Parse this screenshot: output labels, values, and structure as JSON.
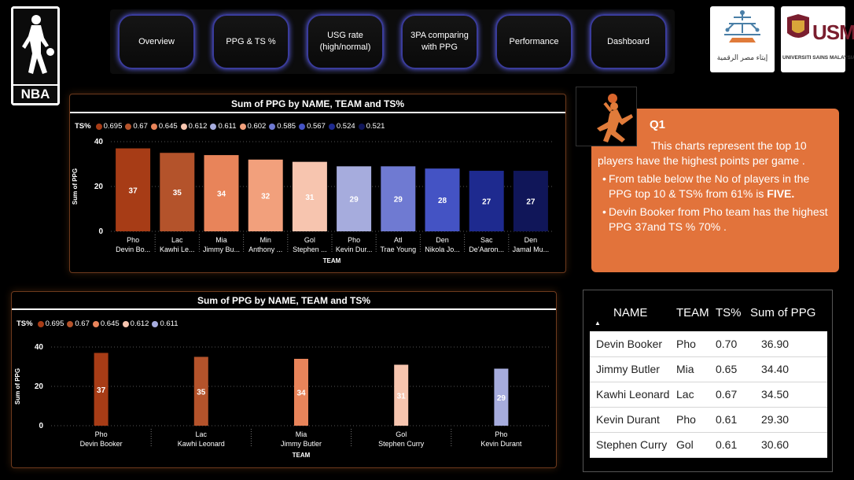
{
  "logos": {
    "nba_text": "NBA",
    "egypt_text": "إيتاء مصر الرقمية",
    "usm_short": "USM",
    "usm_text": "UNIVERSITI SAINS MALAYSIA"
  },
  "nav": {
    "buttons": [
      {
        "label": "Overview"
      },
      {
        "label": "PPG & TS %"
      },
      {
        "label": "USG rate (high/normal)"
      },
      {
        "label": "3PA comparing with PPG"
      },
      {
        "label": "Performance"
      },
      {
        "label": "Dashboard"
      }
    ]
  },
  "colors": {
    "c0695": "#a73c16",
    "c067": "#b4532b",
    "c0645": "#e8845a",
    "c0612": "#f7c5af",
    "c0611": "#a6acdd",
    "c0602": "#f2a07c",
    "c0585": "#6f7ad2",
    "c0567": "#4453c4",
    "c0524": "#1e2a8f",
    "c0521": "#101659",
    "info_bg": "#e2733b",
    "card_border": "#6e3a1d",
    "nav_border": "#3a3c9c"
  },
  "chart_data": [
    {
      "type": "bar",
      "title": "Sum of PPG by NAME, TEAM and TS%",
      "xlabel": "TEAM",
      "ylabel": "Sum of PPG",
      "ylim": [
        0,
        40
      ],
      "yticks": [
        "0",
        "20",
        "40"
      ],
      "legend_title": "TS%",
      "legend": [
        "0.695",
        "0.67",
        "0.645",
        "0.612",
        "0.611",
        "0.602",
        "0.585",
        "0.567",
        "0.524",
        "0.521"
      ],
      "legend_colors": [
        "c0695",
        "c067",
        "c0645",
        "c0612",
        "c0611",
        "c0602",
        "c0585",
        "c0567",
        "c0524",
        "c0521"
      ],
      "categories_team": [
        "Pho",
        "Lac",
        "Mia",
        "Min",
        "Gol",
        "Pho",
        "Atl",
        "Den",
        "Sac",
        "Den"
      ],
      "categories_name": [
        "Devin Bo...",
        "Kawhi Le...",
        "Jimmy Bu...",
        "Anthony ...",
        "Stephen ...",
        "Kevin Dur...",
        "Trae Young",
        "Nikola Jo...",
        "De'Aaron...",
        "Jamal Mu..."
      ],
      "values": [
        37,
        35,
        34,
        32,
        31,
        29,
        29,
        28,
        27,
        27
      ],
      "labels": [
        "37",
        "35",
        "34",
        "32",
        "31",
        "29",
        "29",
        "28",
        "27",
        "27"
      ],
      "bar_colors": [
        "c0695",
        "c067",
        "c0645",
        "c0602",
        "c0612",
        "c0611",
        "c0585",
        "c0567",
        "c0524",
        "c0521"
      ]
    },
    {
      "type": "bar",
      "title": "Sum of PPG by NAME, TEAM and TS%",
      "xlabel": "TEAM",
      "ylabel": "Sum of PPG",
      "ylim": [
        0,
        40
      ],
      "yticks": [
        "0",
        "20",
        "40"
      ],
      "legend_title": "TS%",
      "legend": [
        "0.695",
        "0.67",
        "0.645",
        "0.612",
        "0.611"
      ],
      "legend_colors": [
        "c0695",
        "c067",
        "c0645",
        "c0612",
        "c0611"
      ],
      "categories_team": [
        "Pho",
        "Lac",
        "Mia",
        "Gol",
        "Pho"
      ],
      "categories_name": [
        "Devin Booker",
        "Kawhi Leonard",
        "Jimmy Butler",
        "Stephen Curry",
        "Kevin Durant"
      ],
      "values": [
        37,
        35,
        34,
        31,
        29
      ],
      "labels": [
        "37",
        "35",
        "34",
        "31",
        "29"
      ],
      "bar_colors": [
        "c0695",
        "c067",
        "c0645",
        "c0612",
        "c0611"
      ]
    }
  ],
  "info": {
    "heading": "Q1",
    "line1": "This charts represent the top 10 players have the highest points per game .",
    "bullet1_text": "From table below the No of players in the PPG top 10 & TS% from 61% is ",
    "bullet1_bold": "FIVE.",
    "bullet2": "Devin Booker from Pho team has the highest PPG  37and TS %  70% ."
  },
  "table": {
    "headers": [
      "NAME",
      "TEAM",
      "TS%",
      "Sum of PPG"
    ],
    "rows": [
      [
        "Devin Booker",
        "Pho",
        "0.70",
        "36.90"
      ],
      [
        "Jimmy Butler",
        "Mia",
        "0.65",
        "34.40"
      ],
      [
        "Kawhi Leonard",
        "Lac",
        "0.67",
        "34.50"
      ],
      [
        "Kevin Durant",
        "Pho",
        "0.61",
        "29.30"
      ],
      [
        "Stephen Curry",
        "Gol",
        "0.61",
        "30.60"
      ]
    ]
  }
}
